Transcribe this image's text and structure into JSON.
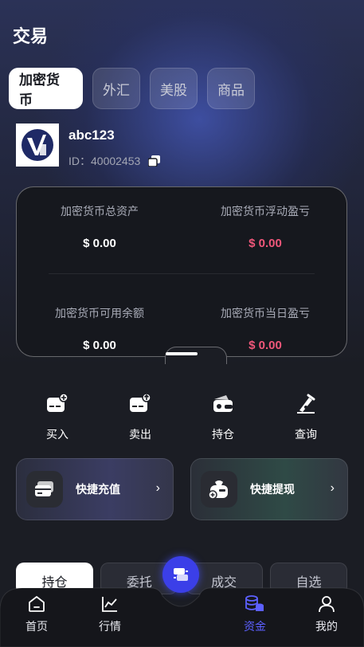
{
  "header": {
    "title": "交易"
  },
  "market_tabs": [
    {
      "label": "加密货币",
      "active": true
    },
    {
      "label": "外汇",
      "active": false
    },
    {
      "label": "美股",
      "active": false
    },
    {
      "label": "商品",
      "active": false
    }
  ],
  "user": {
    "name": "abc123",
    "id_text": "ID：40002453"
  },
  "assets": {
    "total_label": "加密货币总资产",
    "total_value": "$ 0.00",
    "floating_label": "加密货币浮动盈亏",
    "floating_value": "$ 0.00",
    "available_label": "加密货币可用余额",
    "available_value": "$ 0.00",
    "daily_label": "加密货币当日盈亏",
    "daily_value": "$ 0.00"
  },
  "actions": [
    {
      "label": "买入",
      "icon": "wallet-plus-icon"
    },
    {
      "label": "卖出",
      "icon": "wallet-upload-icon"
    },
    {
      "label": "持仓",
      "icon": "holdings-icon"
    },
    {
      "label": "查询",
      "icon": "query-icon"
    }
  ],
  "quick": {
    "deposit_label": "快捷充值",
    "withdraw_label": "快捷提现",
    "arrow": "›"
  },
  "bottom_tabs": [
    {
      "label": "持仓",
      "active": true
    },
    {
      "label": "委托",
      "active": false
    },
    {
      "label": "成交",
      "active": false
    },
    {
      "label": "自选",
      "active": false
    }
  ],
  "nav": [
    {
      "label": "首页",
      "icon": "home-icon",
      "active": false
    },
    {
      "label": "行情",
      "icon": "chart-icon",
      "active": false
    },
    {
      "label": "资金",
      "icon": "coins-icon",
      "active": true
    },
    {
      "label": "我的",
      "icon": "profile-icon",
      "active": false
    }
  ],
  "colors": {
    "accent": "#3b3fe8",
    "loss": "#f0577a",
    "active_nav": "#5c60ff"
  }
}
